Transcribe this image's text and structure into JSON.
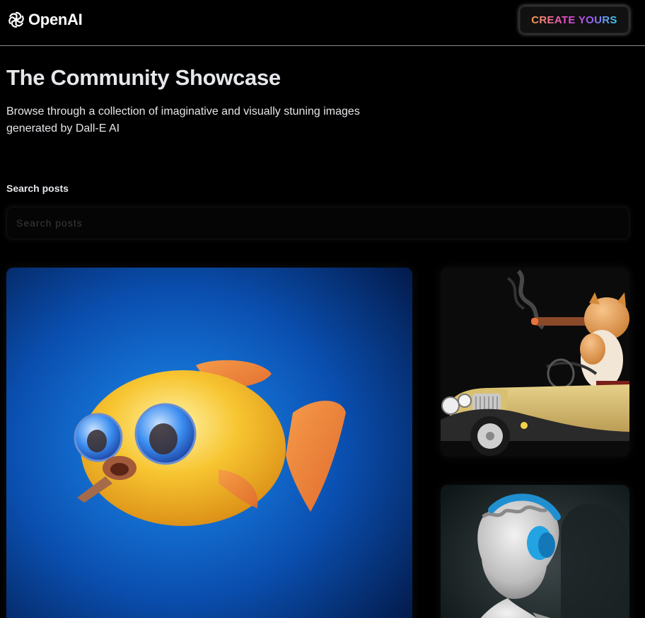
{
  "header": {
    "brand": "OpenAI",
    "logo_icon": "openai-logo-icon",
    "create_button_label": "CREATE YOURS",
    "create_gradient": [
      "#f6a04d",
      "#e64bc6",
      "#9b5cf6",
      "#38d5f0"
    ]
  },
  "hero": {
    "title": "The Community Showcase",
    "subtitle": "Browse through a collection of imaginative and visually stuning images generated by Dall-E AI"
  },
  "search": {
    "label": "Search posts",
    "placeholder": "Search posts",
    "value": ""
  },
  "gallery": {
    "items": [
      {
        "image": "yellow-fish-image"
      },
      {
        "image": "cat-smoking-cigar-in-car-image"
      },
      {
        "image": "statue-with-headphones-image"
      }
    ]
  },
  "colors": {
    "background": "#000000",
    "text": "#e5e7eb",
    "divider": "#8a8a8a"
  }
}
